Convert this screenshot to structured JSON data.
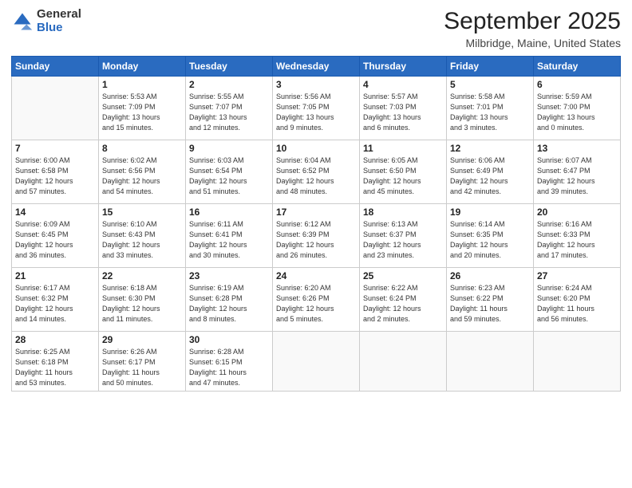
{
  "logo": {
    "general": "General",
    "blue": "Blue"
  },
  "header": {
    "month": "September 2025",
    "location": "Milbridge, Maine, United States"
  },
  "days_of_week": [
    "Sunday",
    "Monday",
    "Tuesday",
    "Wednesday",
    "Thursday",
    "Friday",
    "Saturday"
  ],
  "weeks": [
    [
      {
        "day": "",
        "info": ""
      },
      {
        "day": "1",
        "info": "Sunrise: 5:53 AM\nSunset: 7:09 PM\nDaylight: 13 hours\nand 15 minutes."
      },
      {
        "day": "2",
        "info": "Sunrise: 5:55 AM\nSunset: 7:07 PM\nDaylight: 13 hours\nand 12 minutes."
      },
      {
        "day": "3",
        "info": "Sunrise: 5:56 AM\nSunset: 7:05 PM\nDaylight: 13 hours\nand 9 minutes."
      },
      {
        "day": "4",
        "info": "Sunrise: 5:57 AM\nSunset: 7:03 PM\nDaylight: 13 hours\nand 6 minutes."
      },
      {
        "day": "5",
        "info": "Sunrise: 5:58 AM\nSunset: 7:01 PM\nDaylight: 13 hours\nand 3 minutes."
      },
      {
        "day": "6",
        "info": "Sunrise: 5:59 AM\nSunset: 7:00 PM\nDaylight: 13 hours\nand 0 minutes."
      }
    ],
    [
      {
        "day": "7",
        "info": "Sunrise: 6:00 AM\nSunset: 6:58 PM\nDaylight: 12 hours\nand 57 minutes."
      },
      {
        "day": "8",
        "info": "Sunrise: 6:02 AM\nSunset: 6:56 PM\nDaylight: 12 hours\nand 54 minutes."
      },
      {
        "day": "9",
        "info": "Sunrise: 6:03 AM\nSunset: 6:54 PM\nDaylight: 12 hours\nand 51 minutes."
      },
      {
        "day": "10",
        "info": "Sunrise: 6:04 AM\nSunset: 6:52 PM\nDaylight: 12 hours\nand 48 minutes."
      },
      {
        "day": "11",
        "info": "Sunrise: 6:05 AM\nSunset: 6:50 PM\nDaylight: 12 hours\nand 45 minutes."
      },
      {
        "day": "12",
        "info": "Sunrise: 6:06 AM\nSunset: 6:49 PM\nDaylight: 12 hours\nand 42 minutes."
      },
      {
        "day": "13",
        "info": "Sunrise: 6:07 AM\nSunset: 6:47 PM\nDaylight: 12 hours\nand 39 minutes."
      }
    ],
    [
      {
        "day": "14",
        "info": "Sunrise: 6:09 AM\nSunset: 6:45 PM\nDaylight: 12 hours\nand 36 minutes."
      },
      {
        "day": "15",
        "info": "Sunrise: 6:10 AM\nSunset: 6:43 PM\nDaylight: 12 hours\nand 33 minutes."
      },
      {
        "day": "16",
        "info": "Sunrise: 6:11 AM\nSunset: 6:41 PM\nDaylight: 12 hours\nand 30 minutes."
      },
      {
        "day": "17",
        "info": "Sunrise: 6:12 AM\nSunset: 6:39 PM\nDaylight: 12 hours\nand 26 minutes."
      },
      {
        "day": "18",
        "info": "Sunrise: 6:13 AM\nSunset: 6:37 PM\nDaylight: 12 hours\nand 23 minutes."
      },
      {
        "day": "19",
        "info": "Sunrise: 6:14 AM\nSunset: 6:35 PM\nDaylight: 12 hours\nand 20 minutes."
      },
      {
        "day": "20",
        "info": "Sunrise: 6:16 AM\nSunset: 6:33 PM\nDaylight: 12 hours\nand 17 minutes."
      }
    ],
    [
      {
        "day": "21",
        "info": "Sunrise: 6:17 AM\nSunset: 6:32 PM\nDaylight: 12 hours\nand 14 minutes."
      },
      {
        "day": "22",
        "info": "Sunrise: 6:18 AM\nSunset: 6:30 PM\nDaylight: 12 hours\nand 11 minutes."
      },
      {
        "day": "23",
        "info": "Sunrise: 6:19 AM\nSunset: 6:28 PM\nDaylight: 12 hours\nand 8 minutes."
      },
      {
        "day": "24",
        "info": "Sunrise: 6:20 AM\nSunset: 6:26 PM\nDaylight: 12 hours\nand 5 minutes."
      },
      {
        "day": "25",
        "info": "Sunrise: 6:22 AM\nSunset: 6:24 PM\nDaylight: 12 hours\nand 2 minutes."
      },
      {
        "day": "26",
        "info": "Sunrise: 6:23 AM\nSunset: 6:22 PM\nDaylight: 11 hours\nand 59 minutes."
      },
      {
        "day": "27",
        "info": "Sunrise: 6:24 AM\nSunset: 6:20 PM\nDaylight: 11 hours\nand 56 minutes."
      }
    ],
    [
      {
        "day": "28",
        "info": "Sunrise: 6:25 AM\nSunset: 6:18 PM\nDaylight: 11 hours\nand 53 minutes."
      },
      {
        "day": "29",
        "info": "Sunrise: 6:26 AM\nSunset: 6:17 PM\nDaylight: 11 hours\nand 50 minutes."
      },
      {
        "day": "30",
        "info": "Sunrise: 6:28 AM\nSunset: 6:15 PM\nDaylight: 11 hours\nand 47 minutes."
      },
      {
        "day": "",
        "info": ""
      },
      {
        "day": "",
        "info": ""
      },
      {
        "day": "",
        "info": ""
      },
      {
        "day": "",
        "info": ""
      }
    ]
  ]
}
